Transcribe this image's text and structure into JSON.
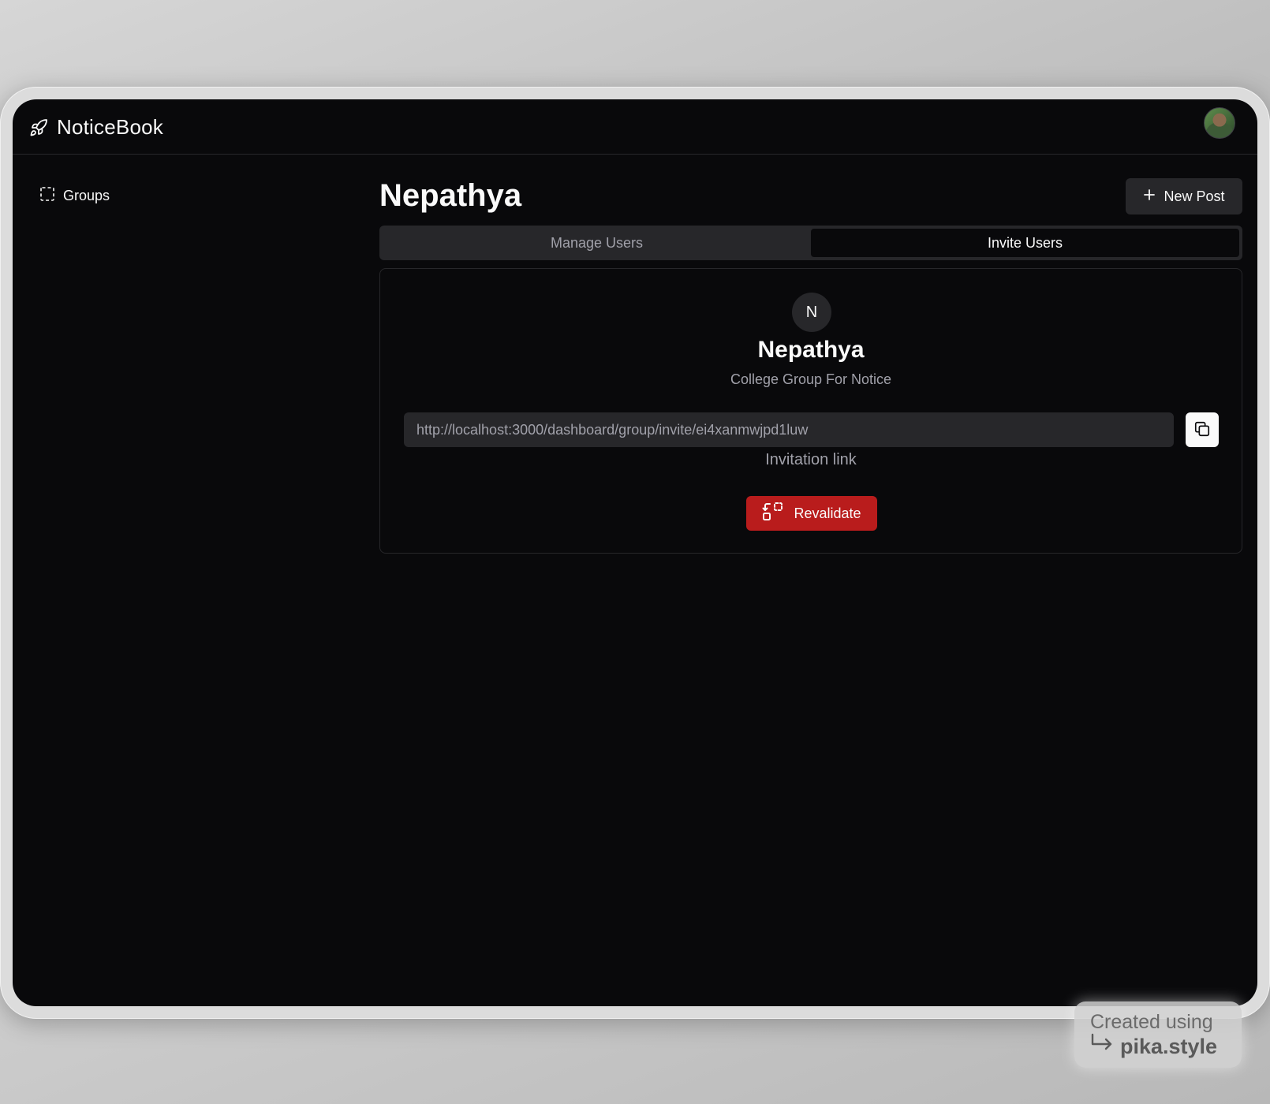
{
  "app": {
    "name": "NoticeBook"
  },
  "sidebar": {
    "items": [
      {
        "label": "Groups"
      }
    ]
  },
  "main": {
    "title": "Nepathya",
    "new_post_label": "New Post",
    "tabs": [
      {
        "label": "Manage Users",
        "active": false
      },
      {
        "label": "Invite Users",
        "active": true
      }
    ]
  },
  "invite_card": {
    "avatar_letter": "N",
    "group_name": "Nepathya",
    "group_description": "College Group For Notice",
    "invite_link": "http://localhost:3000/dashboard/group/invite/ei4xanmwjpd1luw",
    "invite_label": "Invitation link",
    "revalidate_label": "Revalidate"
  },
  "watermark": {
    "line1": "Created using",
    "line2": "pika.style"
  },
  "colors": {
    "background": "#09090b",
    "surface": "#27272a",
    "text": "#fafafa",
    "muted_text": "#a1a1aa",
    "danger": "#b91c1c"
  }
}
